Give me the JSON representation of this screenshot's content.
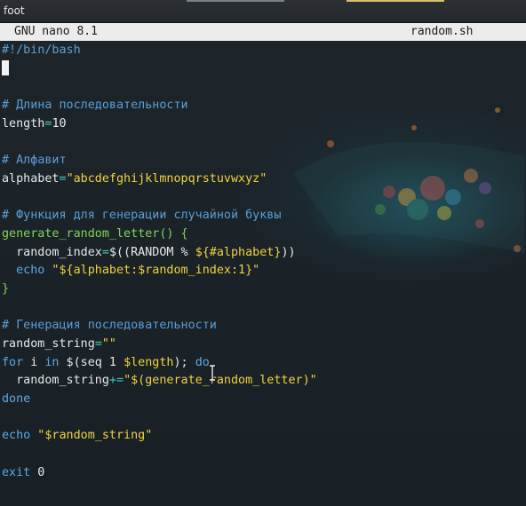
{
  "window": {
    "title": "foot"
  },
  "nano": {
    "version": "GNU nano 8.1",
    "filename": "random.sh"
  },
  "editor": {
    "lines": [
      [
        {
          "t": "#!/bin/bash",
          "c": "comment"
        }
      ],
      [
        {
          "t": "",
          "c": "cursor"
        }
      ],
      [
        {
          "t": "",
          "c": "plain"
        }
      ],
      [
        {
          "t": "# Длина последовательности",
          "c": "comment"
        }
      ],
      [
        {
          "t": "length",
          "c": "plain"
        },
        {
          "t": "=",
          "c": "op"
        },
        {
          "t": "10",
          "c": "num"
        }
      ],
      [
        {
          "t": "",
          "c": "plain"
        }
      ],
      [
        {
          "t": "# Алфавит",
          "c": "comment"
        }
      ],
      [
        {
          "t": "alphabet",
          "c": "plain"
        },
        {
          "t": "=",
          "c": "op"
        },
        {
          "t": "\"abcdefghijklmnopqrstuvwxyz\"",
          "c": "str"
        }
      ],
      [
        {
          "t": "",
          "c": "plain"
        }
      ],
      [
        {
          "t": "# Функция для генерации случайной буквы",
          "c": "comment"
        }
      ],
      [
        {
          "t": "generate_random_letter() {",
          "c": "func"
        }
      ],
      [
        {
          "t": "  random_index",
          "c": "plain"
        },
        {
          "t": "=",
          "c": "op"
        },
        {
          "t": "$((RANDOM % ",
          "c": "plain"
        },
        {
          "t": "${#alphabet}",
          "c": "var"
        },
        {
          "t": "))",
          "c": "plain"
        }
      ],
      [
        {
          "t": "  ",
          "c": "plain"
        },
        {
          "t": "echo",
          "c": "kw"
        },
        {
          "t": " \"${alphabet:$random_index:1}\"",
          "c": "str"
        }
      ],
      [
        {
          "t": "}",
          "c": "func"
        }
      ],
      [
        {
          "t": "",
          "c": "plain"
        }
      ],
      [
        {
          "t": "# Генерация последовательности",
          "c": "comment"
        }
      ],
      [
        {
          "t": "random_string",
          "c": "plain"
        },
        {
          "t": "=",
          "c": "op"
        },
        {
          "t": "\"\"",
          "c": "str"
        }
      ],
      [
        {
          "t": "for",
          "c": "kw"
        },
        {
          "t": " i ",
          "c": "plain"
        },
        {
          "t": "in",
          "c": "kw"
        },
        {
          "t": " $(seq 1 ",
          "c": "plain"
        },
        {
          "t": "$length",
          "c": "var"
        },
        {
          "t": "); ",
          "c": "plain"
        },
        {
          "t": "do",
          "c": "kw"
        }
      ],
      [
        {
          "t": "  random_string",
          "c": "plain"
        },
        {
          "t": "+=",
          "c": "op"
        },
        {
          "t": "\"$(generate_random_letter)\"",
          "c": "str"
        }
      ],
      [
        {
          "t": "done",
          "c": "kw"
        }
      ],
      [
        {
          "t": "",
          "c": "plain"
        }
      ],
      [
        {
          "t": "echo",
          "c": "kw"
        },
        {
          "t": " \"$random_string\"",
          "c": "str"
        }
      ],
      [
        {
          "t": "",
          "c": "plain"
        }
      ],
      [
        {
          "t": "exit",
          "c": "kw"
        },
        {
          "t": " 0",
          "c": "num"
        }
      ]
    ]
  },
  "colors": {
    "comment": "#5b9ed6",
    "keyword": "#5aa9e6",
    "string": "#f0d23c",
    "function": "#7fd45a",
    "operator": "#45c8c0",
    "text": "#e8e8e8",
    "header_bg": "#ececec"
  },
  "icons": {
    "mouse_pointer": "text-cursor-ibeam-icon"
  }
}
